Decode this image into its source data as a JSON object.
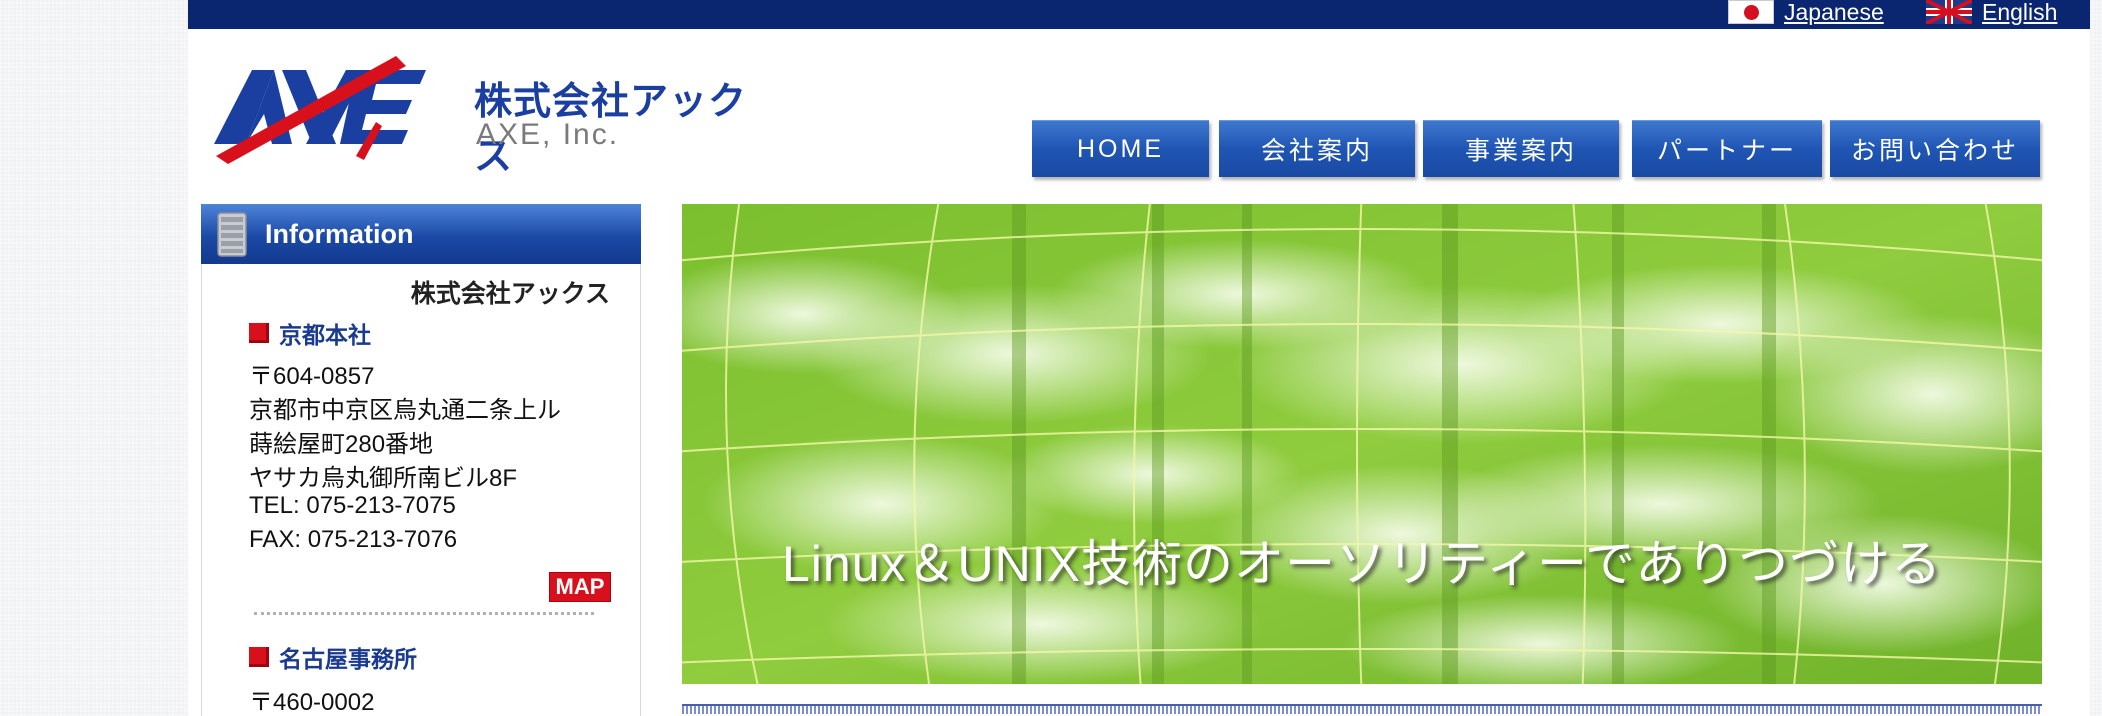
{
  "languages": [
    {
      "label": "Japanese",
      "icon": "japan-flag-icon"
    },
    {
      "label": "English",
      "icon": "uk-flag-icon"
    }
  ],
  "brand": {
    "logo_text": "AXE",
    "name_jp": "株式会社アックス",
    "name_en": "AXE, Inc.",
    "colors": {
      "navy": "#0b2670",
      "logo_blue": "#1a3fa0",
      "logo_red": "#d8101c"
    }
  },
  "nav": {
    "items": [
      "HOME",
      "会社案内",
      "事業案内",
      "パートナー",
      "お問い合わせ"
    ]
  },
  "sidebar": {
    "header": "Information",
    "header_icon": "server-icon",
    "company": "株式会社アックス",
    "offices": [
      {
        "name": "京都本社",
        "lines": [
          "〒604-0857",
          "京都市中京区烏丸通二条上ル",
          "蒔絵屋町280番地",
          "ヤサカ烏丸御所南ビル8F",
          "TEL: 075-213-7075",
          "FAX: 075-213-7076"
        ],
        "map_label": "MAP"
      },
      {
        "name": "名古屋事務所",
        "lines": [
          "〒460-0002"
        ]
      }
    ]
  },
  "hero": {
    "tagline": "Linux＆UNIX技術のオーソリティーでありつづける",
    "image_description_colors": {
      "green": "#8ccc3a",
      "light": "#e9f7d2"
    }
  }
}
